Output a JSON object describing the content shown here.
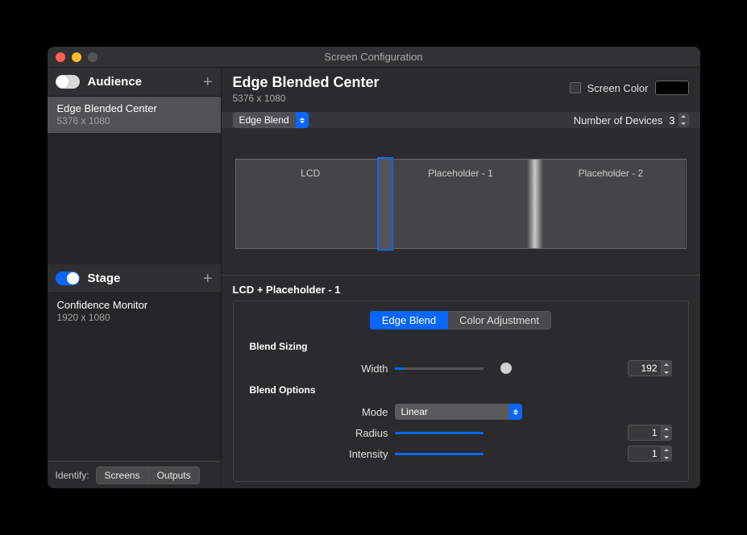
{
  "window": {
    "title": "Screen Configuration"
  },
  "sidebar": {
    "audience": {
      "label": "Audience",
      "toggle": false,
      "items": [
        {
          "name": "Edge Blended Center",
          "resolution": "5376 x 1080",
          "selected": true
        }
      ]
    },
    "stage": {
      "label": "Stage",
      "toggle": true,
      "items": [
        {
          "name": "Confidence Monitor",
          "resolution": "1920 x 1080",
          "selected": false
        }
      ]
    },
    "identify": {
      "label": "Identify:",
      "screens": "Screens",
      "outputs": "Outputs"
    }
  },
  "main": {
    "title": "Edge Blended Center",
    "resolution": "5376 x 1080",
    "screen_color": {
      "label": "Screen Color",
      "checked": false,
      "value": "#000000"
    },
    "mode_dropdown": "Edge Blend",
    "num_devices": {
      "label": "Number of Devices",
      "value": "3"
    },
    "screens": [
      "LCD",
      "Placeholder - 1",
      "Placeholder - 2"
    ],
    "selected_blend": "LCD + Placeholder - 1",
    "tabs": {
      "edge_blend": "Edge Blend",
      "color_adjustment": "Color Adjustment",
      "active": 0
    },
    "blend_sizing": {
      "label": "Blend Sizing",
      "width": {
        "label": "Width",
        "value": "192",
        "percent": 10
      }
    },
    "blend_options": {
      "label": "Blend Options",
      "mode": {
        "label": "Mode",
        "value": "Linear"
      },
      "radius": {
        "label": "Radius",
        "value": "1",
        "percent": 100
      },
      "intensity": {
        "label": "Intensity",
        "value": "1",
        "percent": 100
      }
    }
  }
}
